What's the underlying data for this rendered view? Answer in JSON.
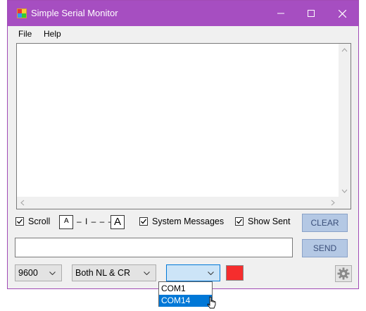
{
  "window": {
    "title": "Simple Serial Monitor"
  },
  "titlebar_controls": {
    "minimize_icon": "minimize-icon",
    "maximize_icon": "maximize-icon",
    "close_icon": "close-icon"
  },
  "menu": {
    "items": [
      {
        "label": "File"
      },
      {
        "label": "Help"
      }
    ]
  },
  "options": {
    "scroll": {
      "label": "Scroll",
      "checked": true
    },
    "font_slider": {
      "small_glyph": "A",
      "track": "– I – – –",
      "large_glyph": "A"
    },
    "system_messages": {
      "label": "System Messages",
      "checked": true
    },
    "show_sent": {
      "label": "Show Sent",
      "checked": true
    }
  },
  "buttons": {
    "clear": "CLEAR",
    "send": "SEND"
  },
  "send_input": {
    "value": ""
  },
  "baud_select": {
    "value": "9600"
  },
  "line_ending_select": {
    "value": "Both NL & CR"
  },
  "port_select": {
    "value": "",
    "options": [
      {
        "label": "COM1",
        "selected": false
      },
      {
        "label": "COM14",
        "selected": true
      }
    ]
  },
  "status": {
    "color": "#f52d2d"
  },
  "colors": {
    "titlebar": "#a64ec1",
    "button": "#b4c8e4",
    "button_text": "#3b4f7a",
    "highlight": "#0078d7"
  }
}
